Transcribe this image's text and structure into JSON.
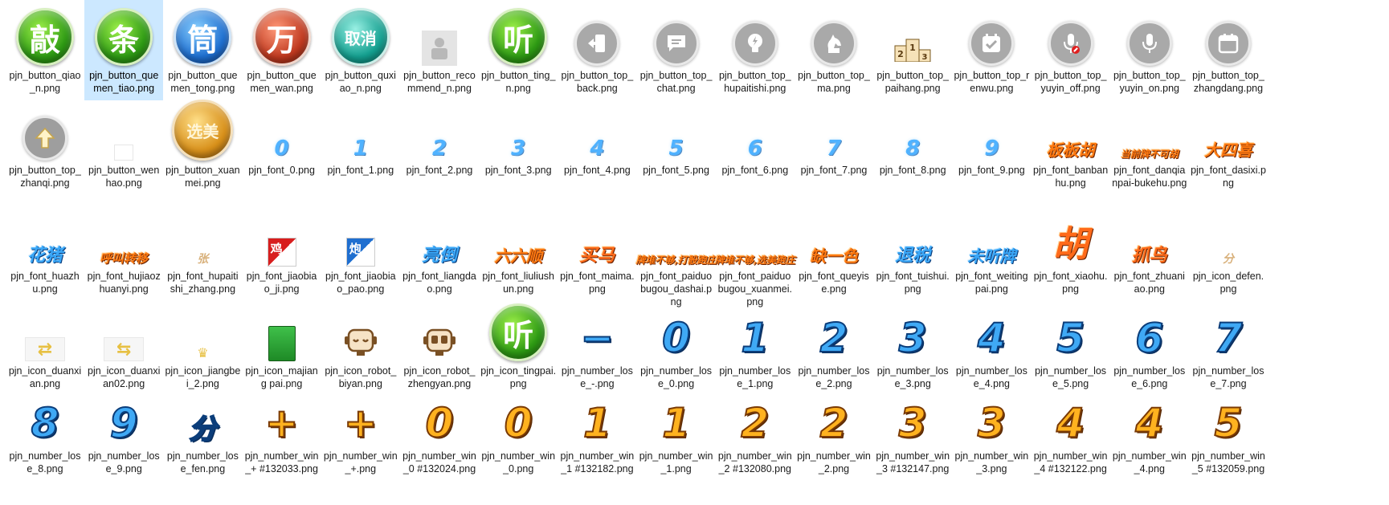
{
  "window": {
    "view": "large-icons",
    "selected_index": 1
  },
  "colors": {
    "selection": "#cce8ff",
    "blue_digit": "#4fb2ff",
    "lose_digit": "#3fa9f5",
    "win_digit": "#ffb21f"
  },
  "files": [
    {
      "label": "pjn_button_qiao_n.png",
      "icon": "circle-green-character-icon",
      "glyph": "敲"
    },
    {
      "label": "pjn_button_quemen_tiao.png",
      "icon": "circle-green-character-icon",
      "glyph": "条"
    },
    {
      "label": "pjn_button_quemen_tong.png",
      "icon": "circle-blue-character-icon",
      "glyph": "筒"
    },
    {
      "label": "pjn_button_quemen_wan.png",
      "icon": "circle-red-character-icon",
      "glyph": "万"
    },
    {
      "label": "pjn_button_quxiao_n.png",
      "icon": "circle-teal-character-icon",
      "glyph": "取消"
    },
    {
      "label": "pjn_button_recommend_n.png",
      "icon": "placeholder-icon",
      "glyph": ""
    },
    {
      "label": "pjn_button_ting_n.png",
      "icon": "circle-green-character-icon",
      "glyph": "听"
    },
    {
      "label": "pjn_button_top_back.png",
      "icon": "back-door-icon",
      "glyph": "⇤"
    },
    {
      "label": "pjn_button_top_chat.png",
      "icon": "chat-bubble-icon",
      "glyph": "💬"
    },
    {
      "label": "pjn_button_top_hupaitishi.png",
      "icon": "lightbulb-icon",
      "glyph": "💡"
    },
    {
      "label": "pjn_button_top_ma.png",
      "icon": "horse-chess-icon",
      "glyph": "♞"
    },
    {
      "label": "pjn_button_top_paihang.png",
      "icon": "podium-icon",
      "glyph": "213"
    },
    {
      "label": "pjn_button_top_renwu.png",
      "icon": "task-calendar-icon",
      "glyph": "✔"
    },
    {
      "label": "pjn_button_top_yuyin_off.png",
      "icon": "mic-off-icon",
      "glyph": "🎤"
    },
    {
      "label": "pjn_button_top_yuyin_on.png",
      "icon": "mic-on-icon",
      "glyph": "🎤"
    },
    {
      "label": "pjn_button_top_zhangdang.png",
      "icon": "calendar-icon",
      "glyph": "▤"
    },
    {
      "label": "pjn_button_top_zhanqi.png",
      "icon": "arrow-up-icon",
      "glyph": "⇧"
    },
    {
      "label": "pjn_button_wenhao.png",
      "icon": "blank-thumbnail-icon",
      "glyph": ""
    },
    {
      "label": "pjn_button_xuanmei.png",
      "icon": "circle-gold-character-icon",
      "glyph": "选美"
    },
    {
      "label": "pjn_font_0.png",
      "icon": "blue-digit-icon",
      "glyph": "0"
    },
    {
      "label": "pjn_font_1.png",
      "icon": "blue-digit-icon",
      "glyph": "1"
    },
    {
      "label": "pjn_font_2.png",
      "icon": "blue-digit-icon",
      "glyph": "2"
    },
    {
      "label": "pjn_font_3.png",
      "icon": "blue-digit-icon",
      "glyph": "3"
    },
    {
      "label": "pjn_font_4.png",
      "icon": "blue-digit-icon",
      "glyph": "4"
    },
    {
      "label": "pjn_font_5.png",
      "icon": "blue-digit-icon",
      "glyph": "5"
    },
    {
      "label": "pjn_font_6.png",
      "icon": "blue-digit-icon",
      "glyph": "6"
    },
    {
      "label": "pjn_font_7.png",
      "icon": "blue-digit-icon",
      "glyph": "7"
    },
    {
      "label": "pjn_font_8.png",
      "icon": "blue-digit-icon",
      "glyph": "8"
    },
    {
      "label": "pjn_font_9.png",
      "icon": "blue-digit-icon",
      "glyph": "9"
    },
    {
      "label": "pjn_font_banbanhu.png",
      "icon": "orange-text-icon",
      "glyph": "板板胡"
    },
    {
      "label": "pjn_font_danqianpai-bukehu.png",
      "icon": "orange-text-icon",
      "glyph": "当前牌不可胡"
    },
    {
      "label": "pjn_font_dasixi.png",
      "icon": "orange-text-icon",
      "glyph": "大四喜"
    },
    {
      "label": "pjn_font_huazhu.png",
      "icon": "blue-text-icon",
      "glyph": "花猪"
    },
    {
      "label": "pjn_font_hujiaozhuanyi.png",
      "icon": "orange-text-icon",
      "glyph": "呼叫转移"
    },
    {
      "label": "pjn_font_hupaitishi_zhang.png",
      "icon": "tan-text-icon",
      "glyph": "张"
    },
    {
      "label": "pjn_font_jiaobiao_ji.png",
      "icon": "red-corner-badge-icon",
      "glyph": "鸡"
    },
    {
      "label": "pjn_font_jiaobiao_pao.png",
      "icon": "blue-corner-badge-icon",
      "glyph": "炮"
    },
    {
      "label": "pjn_font_liangdao.png",
      "icon": "blue-text-icon",
      "glyph": "亮倒"
    },
    {
      "label": "pjn_font_liuliushun.png",
      "icon": "orange-text-icon",
      "glyph": "六六顺"
    },
    {
      "label": "pjn_font_maima.png",
      "icon": "orange-text-icon",
      "glyph": "买马"
    },
    {
      "label": "pjn_font_paiduobugou_dashai.png",
      "icon": "orange-text-icon",
      "glyph": "牌堆不够,打骰跑庄"
    },
    {
      "label": "pjn_font_paiduobugou_xuanmei.png",
      "icon": "orange-text-icon",
      "glyph": "牌堆不够,选美跑庄"
    },
    {
      "label": "pjn_font_queyise.png",
      "icon": "orange-text-icon",
      "glyph": "缺一色"
    },
    {
      "label": "pjn_font_tuishui.png",
      "icon": "blue-text-icon",
      "glyph": "退税"
    },
    {
      "label": "pjn_font_weitingpai.png",
      "icon": "blue-text-icon",
      "glyph": "未听牌"
    },
    {
      "label": "pjn_font_xiaohu.png",
      "icon": "orange-text-icon",
      "glyph": "胡"
    },
    {
      "label": "pjn_font_zhuaniao.png",
      "icon": "orange-text-icon",
      "glyph": "抓鸟"
    },
    {
      "label": "pjn_icon_defen.png",
      "icon": "tan-text-icon",
      "glyph": "分"
    },
    {
      "label": "pjn_icon_duanxian.png",
      "icon": "disconnect-icon",
      "glyph": "⇄"
    },
    {
      "label": "pjn_icon_duanxian02.png",
      "icon": "disconnect-icon",
      "glyph": "⇆"
    },
    {
      "label": "pjn_icon_jiangbei_2.png",
      "icon": "trophy-icon",
      "glyph": "♛"
    },
    {
      "label": "pjn_icon_majiang pai.png",
      "icon": "mahjong-tile-icon",
      "glyph": ""
    },
    {
      "label": "pjn_icon_robot_biyan.png",
      "icon": "robot-closed-eyes-icon",
      "glyph": "◡◡"
    },
    {
      "label": "pjn_icon_robot_zhengyan.png",
      "icon": "robot-open-eyes-icon",
      "glyph": "▢▢"
    },
    {
      "label": "pjn_icon_tingpai.png",
      "icon": "circle-green-character-icon",
      "glyph": "听"
    },
    {
      "label": "pjn_number_lose_-.png",
      "icon": "lose-digit-icon",
      "glyph": "−"
    },
    {
      "label": "pjn_number_lose_0.png",
      "icon": "lose-digit-icon",
      "glyph": "0"
    },
    {
      "label": "pjn_number_lose_1.png",
      "icon": "lose-digit-icon",
      "glyph": "1"
    },
    {
      "label": "pjn_number_lose_2.png",
      "icon": "lose-digit-icon",
      "glyph": "2"
    },
    {
      "label": "pjn_number_lose_3.png",
      "icon": "lose-digit-icon",
      "glyph": "3"
    },
    {
      "label": "pjn_number_lose_4.png",
      "icon": "lose-digit-icon",
      "glyph": "4"
    },
    {
      "label": "pjn_number_lose_5.png",
      "icon": "lose-digit-icon",
      "glyph": "5"
    },
    {
      "label": "pjn_number_lose_6.png",
      "icon": "lose-digit-icon",
      "glyph": "6"
    },
    {
      "label": "pjn_number_lose_7.png",
      "icon": "lose-digit-icon",
      "glyph": "7"
    },
    {
      "label": "pjn_number_lose_8.png",
      "icon": "lose-digit-icon",
      "glyph": "8"
    },
    {
      "label": "pjn_number_lose_9.png",
      "icon": "lose-digit-icon",
      "glyph": "9"
    },
    {
      "label": "pjn_number_lose_fen.png",
      "icon": "lose-digit-icon",
      "glyph": "分"
    },
    {
      "label": "pjn_number_win_+ #132033.png",
      "icon": "win-digit-icon",
      "glyph": "+"
    },
    {
      "label": "pjn_number_win_+.png",
      "icon": "win-digit-icon",
      "glyph": "+"
    },
    {
      "label": "pjn_number_win_0 #132024.png",
      "icon": "win-digit-icon",
      "glyph": "0"
    },
    {
      "label": "pjn_number_win_0.png",
      "icon": "win-digit-icon",
      "glyph": "0"
    },
    {
      "label": "pjn_number_win_1 #132182.png",
      "icon": "win-digit-icon",
      "glyph": "1"
    },
    {
      "label": "pjn_number_win_1.png",
      "icon": "win-digit-icon",
      "glyph": "1"
    },
    {
      "label": "pjn_number_win_2 #132080.png",
      "icon": "win-digit-icon",
      "glyph": "2"
    },
    {
      "label": "pjn_number_win_2.png",
      "icon": "win-digit-icon",
      "glyph": "2"
    },
    {
      "label": "pjn_number_win_3 #132147.png",
      "icon": "win-digit-icon",
      "glyph": "3"
    },
    {
      "label": "pjn_number_win_3.png",
      "icon": "win-digit-icon",
      "glyph": "3"
    },
    {
      "label": "pjn_number_win_4 #132122.png",
      "icon": "win-digit-icon",
      "glyph": "4"
    },
    {
      "label": "pjn_number_win_4.png",
      "icon": "win-digit-icon",
      "glyph": "4"
    },
    {
      "label": "pjn_number_win_5 #132059.png",
      "icon": "win-digit-icon",
      "glyph": "5"
    }
  ]
}
